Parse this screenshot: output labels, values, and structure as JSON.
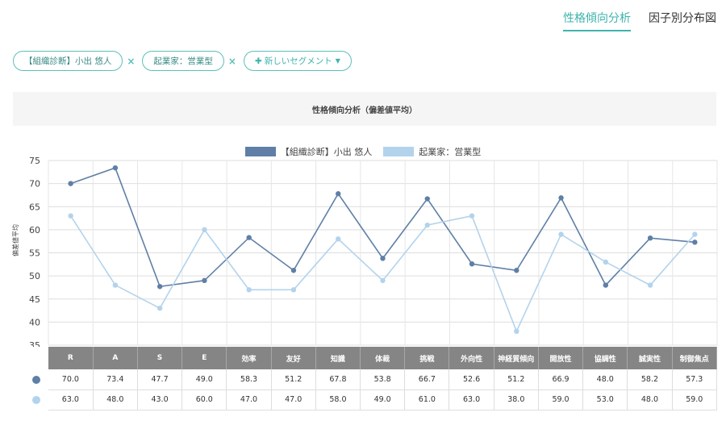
{
  "tabs": [
    {
      "label": "性格傾向分析",
      "active": true
    },
    {
      "label": "因子別分布図",
      "active": false
    }
  ],
  "filters": {
    "chips": [
      "【組織診断】小出 悠人",
      "起業家：営業型"
    ],
    "remove_icon": "×",
    "add_label": "新しいセグメント",
    "add_icon": "plus-icon",
    "filter_icon": "funnel-icon"
  },
  "panel_title": "性格傾向分析（偏差値平均）",
  "chart_data": {
    "type": "line",
    "ylabel": "偏差値平均",
    "ylim": [
      35,
      75
    ],
    "yticks": [
      75,
      70,
      65,
      60,
      55,
      50,
      45,
      40,
      35
    ],
    "categories": [
      "R",
      "A",
      "S",
      "E",
      "効率",
      "友好",
      "知識",
      "体裁",
      "挑戦",
      "外向性",
      "神経質傾向",
      "開放性",
      "協調性",
      "誠実性",
      "制御焦点"
    ],
    "series": [
      {
        "name": "【組織診断】小出 悠人",
        "color": "#5f7fa6",
        "values": [
          70.0,
          73.4,
          47.7,
          49.0,
          58.3,
          51.2,
          67.8,
          53.8,
          66.7,
          52.6,
          51.2,
          66.9,
          48.0,
          58.2,
          57.3
        ],
        "labels": [
          "70.0",
          "73.4",
          "47.7",
          "49.0",
          "58.3",
          "51.2",
          "67.8",
          "53.8",
          "66.7",
          "52.6",
          "51.2",
          "66.9",
          "48.0",
          "58.2",
          "57.3"
        ]
      },
      {
        "name": "起業家：営業型",
        "color": "#b3d3ec",
        "values": [
          63.0,
          48.0,
          43.0,
          60.0,
          47.0,
          47.0,
          58.0,
          49.0,
          61.0,
          63.0,
          38.0,
          59.0,
          53.0,
          48.0,
          59.0
        ],
        "labels": [
          "63.0",
          "48.0",
          "43.0",
          "60.0",
          "47.0",
          "47.0",
          "58.0",
          "49.0",
          "61.0",
          "63.0",
          "38.0",
          "59.0",
          "53.0",
          "48.0",
          "59.0"
        ]
      }
    ]
  }
}
